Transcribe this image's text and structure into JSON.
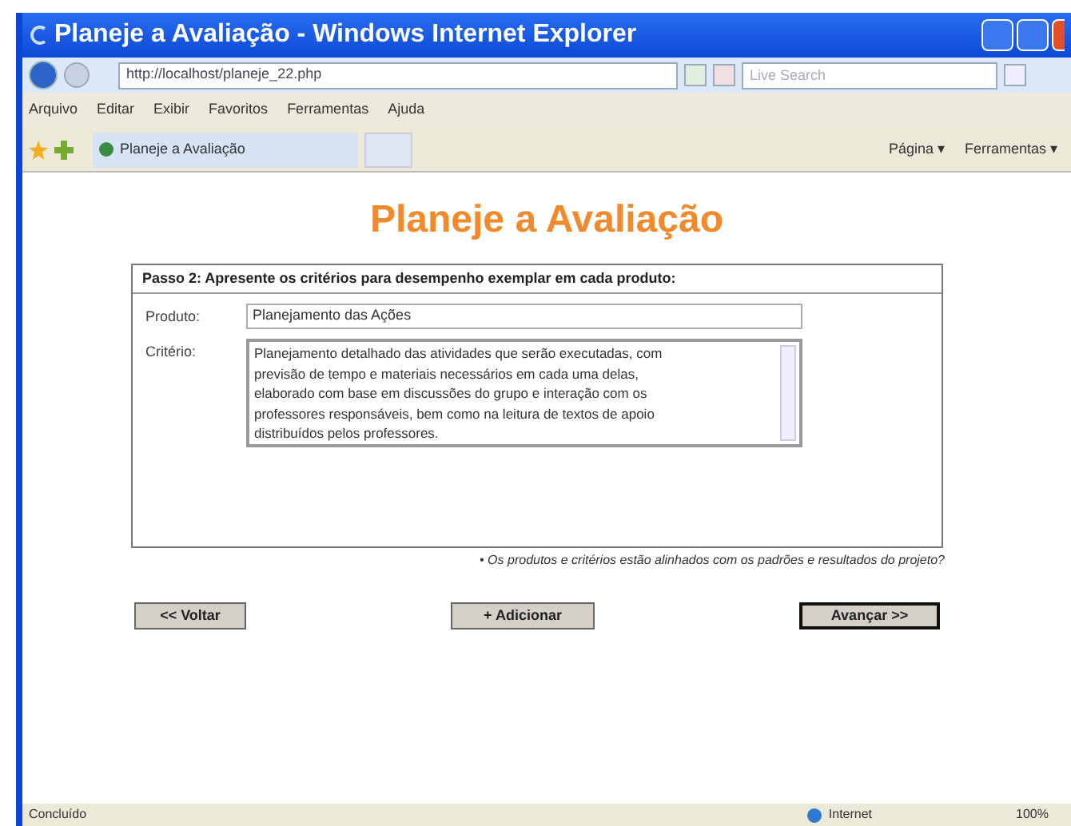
{
  "window": {
    "title": "Planeje a Avaliação - Windows Internet Explorer"
  },
  "address_bar": {
    "url": "http://localhost/planeje_22.php",
    "search_placeholder": "Live Search"
  },
  "menu": [
    "Arquivo",
    "Editar",
    "Exibir",
    "Favoritos",
    "Ferramentas",
    "Ajuda"
  ],
  "tab": {
    "label": "Planeje a Avaliação"
  },
  "toolbar": [
    "Página ▾",
    "Ferramentas ▾"
  ],
  "page": {
    "heading": "Planeje a Avaliação",
    "step": "Passo 2: Apresente os critérios para desempenho exemplar em cada produto:",
    "fields": [
      {
        "label": "Produto:",
        "kind": "input",
        "value": "Planejamento das Ações"
      },
      {
        "label": "Critério:",
        "kind": "textarea",
        "value": "Planejamento detalhado das atividades que serão executadas, com previsão de tempo e materiais necessários em cada uma delas, elaborado com base em discussões do grupo e interação com os professores responsáveis, bem como na leitura de textos de apoio distribuídos pelos professores."
      }
    ],
    "note": "• Os produtos e critérios estão alinhados com os padrões e resultados do projeto?",
    "buttons": [
      {
        "label": "<< Voltar",
        "focused": false
      },
      {
        "label": "+ Adicionar",
        "focused": false
      },
      {
        "label": "Avançar >>",
        "focused": true
      }
    ]
  },
  "status_bar": {
    "text": "Concluído",
    "zone": "Internet",
    "zoom": "100%"
  }
}
